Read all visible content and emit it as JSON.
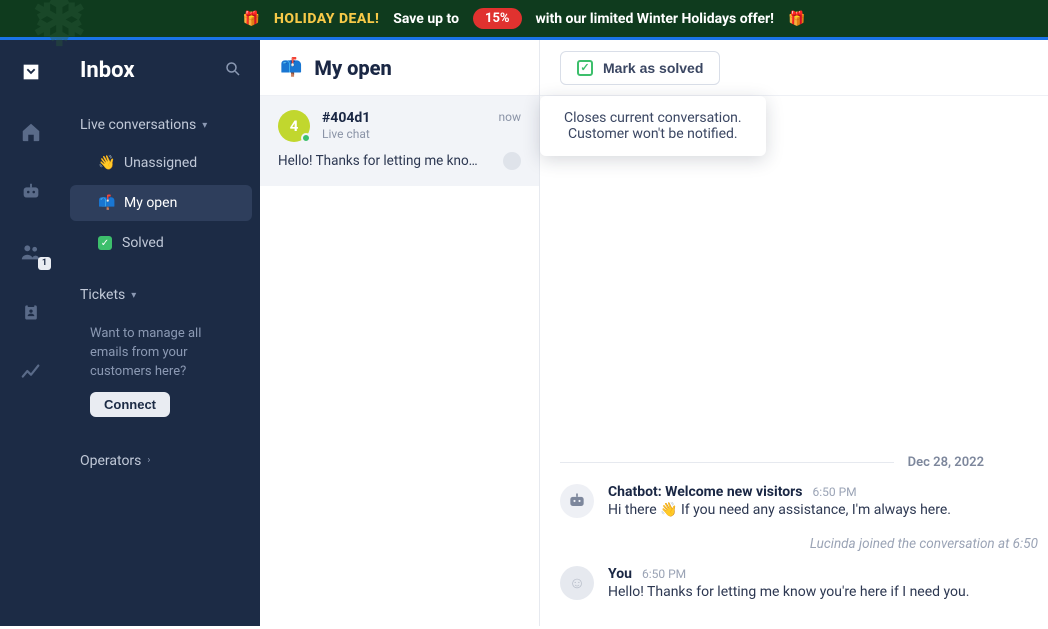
{
  "banner": {
    "deal": "HOLIDAY DEAL!",
    "save": "Save up to",
    "pct": "15%",
    "rest": "with our limited Winter Holidays offer!"
  },
  "sidebar": {
    "title": "Inbox",
    "sections": {
      "live": {
        "label": "Live conversations"
      },
      "tickets": {
        "label": "Tickets"
      },
      "operators": {
        "label": "Operators"
      }
    },
    "items": [
      {
        "label": "Unassigned"
      },
      {
        "label": "My open"
      },
      {
        "label": "Solved"
      }
    ],
    "tickets_hint": "Want to manage all emails from your customers here?",
    "connect": "Connect"
  },
  "rail": {
    "visitors_badge": "1"
  },
  "list": {
    "title": "My open",
    "items": [
      {
        "avatar_initial": "4",
        "name": "#404d1",
        "channel": "Live chat",
        "time": "now",
        "preview": "Hello! Thanks for letting me kno…"
      }
    ]
  },
  "chat": {
    "mark_solved": "Mark as solved",
    "tooltip_l1": "Closes current conversation.",
    "tooltip_l2": "Customer won't be notified.",
    "date": "Dec 28, 2022",
    "messages": [
      {
        "author": "Chatbot: Welcome new visitors",
        "time": "6:50 PM",
        "text": "Hi there 👋 If you need any assistance, I'm always here."
      },
      {
        "author": "You",
        "time": "6:50 PM",
        "text": "Hello! Thanks for letting me know you're here if I need you."
      }
    ],
    "join_note": "Lucinda joined the conversation at 6:50 "
  }
}
